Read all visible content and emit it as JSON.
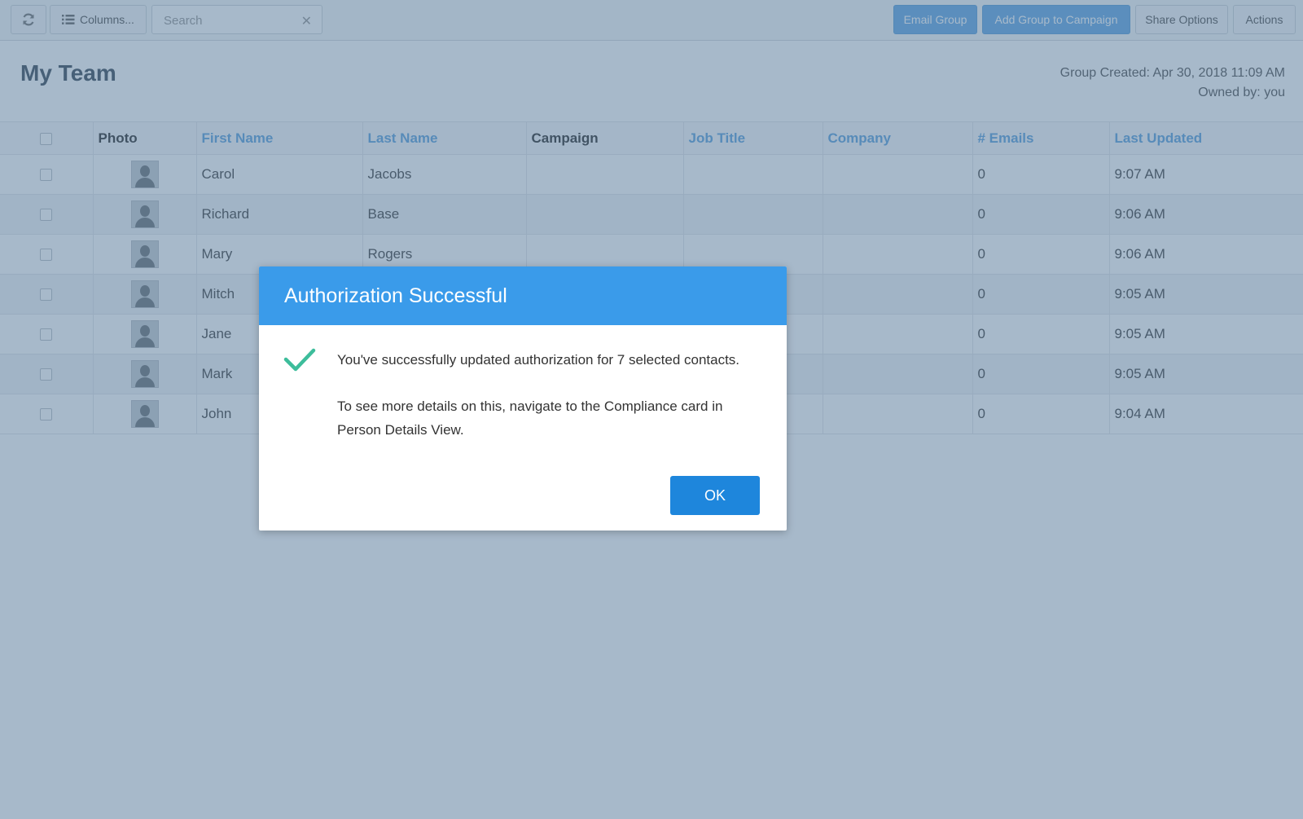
{
  "toolbar": {
    "refresh_icon": "refresh-icon",
    "columns_label": "Columns...",
    "search_placeholder": "Search",
    "search_clear": "✕",
    "email_group": "Email Group",
    "add_to_campaign": "Add Group to Campaign",
    "share_options": "Share Options",
    "actions": "Actions",
    "primary_color": "#66a9e4"
  },
  "header": {
    "title": "My Team",
    "group_created": "Group Created: Apr 30, 2018 11:09 AM",
    "owned_by": "Owned by: you"
  },
  "table": {
    "columns": [
      "Photo",
      "First Name",
      "Last Name",
      "Campaign",
      "Job Title",
      "Company",
      "# Emails",
      "Last Updated"
    ],
    "rows": [
      {
        "first": "Carol",
        "last": "Jacobs",
        "campaign": "",
        "job": "",
        "company": "",
        "emails": "0",
        "updated": "9:07 AM"
      },
      {
        "first": "Richard",
        "last": "Base",
        "campaign": "",
        "job": "",
        "company": "",
        "emails": "0",
        "updated": "9:06 AM"
      },
      {
        "first": "Mary",
        "last": "Rogers",
        "campaign": "",
        "job": "",
        "company": "",
        "emails": "0",
        "updated": "9:06 AM"
      },
      {
        "first": "Mitch",
        "last": "",
        "campaign": "",
        "job": "",
        "company": "",
        "emails": "0",
        "updated": "9:05 AM"
      },
      {
        "first": "Jane",
        "last": "",
        "campaign": "",
        "job": "",
        "company": "",
        "emails": "0",
        "updated": "9:05 AM"
      },
      {
        "first": "Mark",
        "last": "",
        "campaign": "",
        "job": "",
        "company": "",
        "emails": "0",
        "updated": "9:05 AM"
      },
      {
        "first": "John",
        "last": "",
        "campaign": "",
        "job": "",
        "company": "",
        "emails": "0",
        "updated": "9:04 AM"
      }
    ]
  },
  "modal": {
    "title": "Authorization Successful",
    "message": "You've successfully updated authorization for 7 selected contacts.",
    "details": "To see more details on this, navigate to the Compliance card in Person Details View.",
    "ok_label": "OK",
    "header_color": "#3a9bea",
    "check_color": "#3dbd9b"
  }
}
